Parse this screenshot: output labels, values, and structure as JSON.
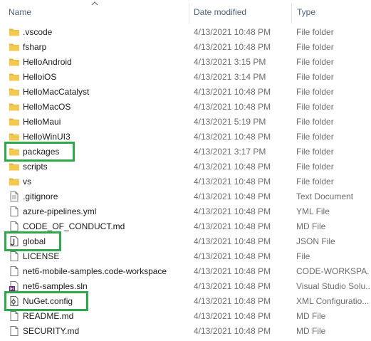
{
  "columns": {
    "name": "Name",
    "date_modified": "Date modified",
    "type": "Type"
  },
  "sort": {
    "column": "name",
    "direction": "ascending"
  },
  "colors": {
    "folder": "#f0c24a",
    "highlight": "#2ea84a",
    "header_text": "#4c607a",
    "meta_text": "#6d6d6d"
  },
  "rows": [
    {
      "name": ".vscode",
      "date": "4/13/2021 10:48 PM",
      "type": "File folder",
      "icon": "folder-icon"
    },
    {
      "name": "fsharp",
      "date": "4/13/2021 10:48 PM",
      "type": "File folder",
      "icon": "folder-icon"
    },
    {
      "name": "HelloAndroid",
      "date": "4/13/2021 3:15 PM",
      "type": "File folder",
      "icon": "folder-icon"
    },
    {
      "name": "HelloiOS",
      "date": "4/13/2021 3:14 PM",
      "type": "File folder",
      "icon": "folder-icon"
    },
    {
      "name": "HelloMacCatalyst",
      "date": "4/13/2021 10:48 PM",
      "type": "File folder",
      "icon": "folder-icon"
    },
    {
      "name": "HelloMacOS",
      "date": "4/13/2021 10:48 PM",
      "type": "File folder",
      "icon": "folder-icon"
    },
    {
      "name": "HelloMaui",
      "date": "4/13/2021 5:19 PM",
      "type": "File folder",
      "icon": "folder-icon"
    },
    {
      "name": "HelloWinUI3",
      "date": "4/13/2021 10:48 PM",
      "type": "File folder",
      "icon": "folder-icon"
    },
    {
      "name": "packages",
      "date": "4/13/2021 3:17 PM",
      "type": "File folder",
      "icon": "folder-icon",
      "highlighted": true
    },
    {
      "name": "scripts",
      "date": "4/13/2021 10:48 PM",
      "type": "File folder",
      "icon": "folder-icon"
    },
    {
      "name": "vs",
      "date": "4/13/2021 10:48 PM",
      "type": "File folder",
      "icon": "folder-icon"
    },
    {
      "name": ".gitignore",
      "date": "4/13/2021 10:48 PM",
      "type": "Text Document",
      "icon": "text-document-icon"
    },
    {
      "name": "azure-pipelines.yml",
      "date": "4/13/2021 10:48 PM",
      "type": "YML File",
      "icon": "file-icon"
    },
    {
      "name": "CODE_OF_CONDUCT.md",
      "date": "4/13/2021 10:48 PM",
      "type": "MD File",
      "icon": "file-icon"
    },
    {
      "name": "global",
      "date": "4/13/2021 10:48 PM",
      "type": "JSON File",
      "icon": "json-file-icon",
      "highlighted": true
    },
    {
      "name": "LICENSE",
      "date": "4/13/2021 10:48 PM",
      "type": "File",
      "icon": "file-icon"
    },
    {
      "name": "net6-mobile-samples.code-workspace",
      "date": "4/13/2021 10:48 PM",
      "type": "CODE-WORKSPA...",
      "icon": "file-icon"
    },
    {
      "name": "net6-samples.sln",
      "date": "4/13/2021 10:48 PM",
      "type": "Visual Studio Solu...",
      "icon": "visual-studio-solution-icon"
    },
    {
      "name": "NuGet.config",
      "date": "4/13/2021 10:48 PM",
      "type": "XML Configuratio...",
      "icon": "config-file-icon",
      "highlighted": true
    },
    {
      "name": "README.md",
      "date": "4/13/2021 10:48 PM",
      "type": "MD File",
      "icon": "file-icon"
    },
    {
      "name": "SECURITY.md",
      "date": "4/13/2021 10:48 PM",
      "type": "MD File",
      "icon": "file-icon"
    }
  ]
}
